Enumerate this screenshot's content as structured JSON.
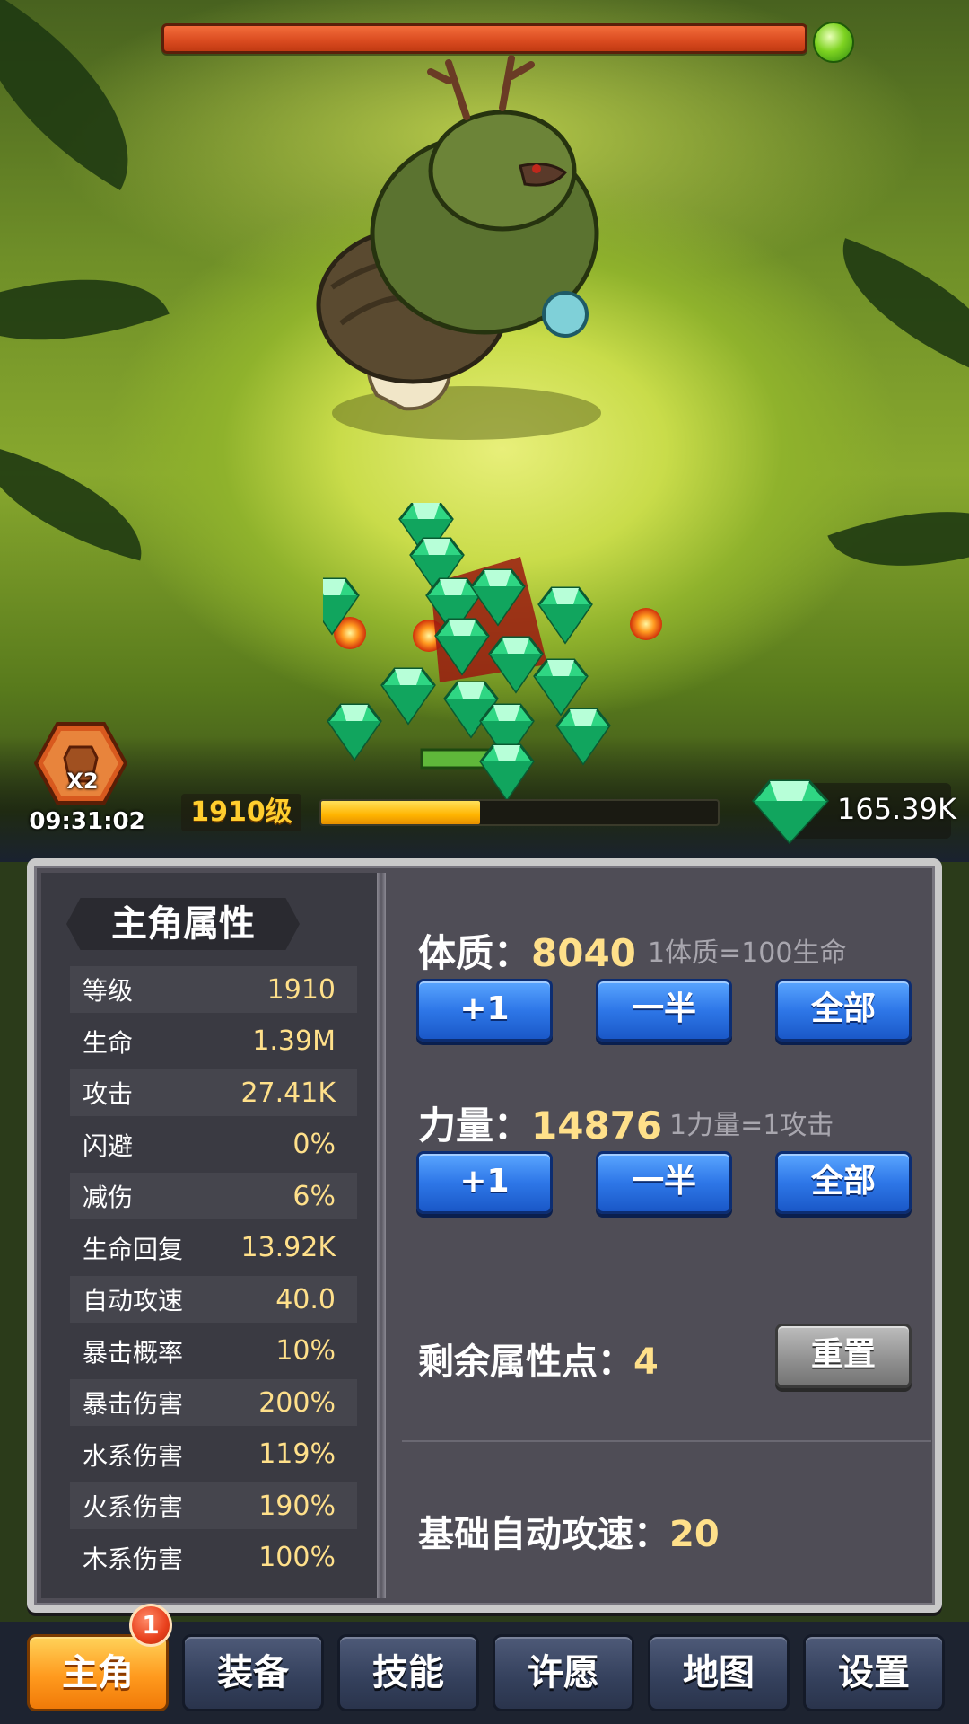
{
  "battle": {
    "boss_hp_percent": 100,
    "buff_label": "X2",
    "timer": "09:31:02",
    "level_label": "1910级",
    "exp_progress": 0.4,
    "gem_total": "165.39K"
  },
  "stats_panel": {
    "title": "主角属性",
    "rows": [
      {
        "label": "等级",
        "value": "1910"
      },
      {
        "label": "生命",
        "value": "1.39M"
      },
      {
        "label": "攻击",
        "value": "27.41K"
      },
      {
        "label": "闪避",
        "value": "0%"
      },
      {
        "label": "减伤",
        "value": "6%"
      },
      {
        "label": "生命回复",
        "value": "13.92K"
      },
      {
        "label": "自动攻速",
        "value": "40.0"
      },
      {
        "label": "暴击概率",
        "value": "10%"
      },
      {
        "label": "暴击伤害",
        "value": "200%"
      },
      {
        "label": "水系伤害",
        "value": "119%"
      },
      {
        "label": "火系伤害",
        "value": "190%"
      },
      {
        "label": "木系伤害",
        "value": "100%"
      }
    ]
  },
  "attributes": {
    "constitution": {
      "label": "体质：",
      "value": "8040",
      "note": "1体质=100生命",
      "buttons": [
        "+1",
        "一半",
        "全部"
      ]
    },
    "strength": {
      "label": "力量：",
      "value": "14876",
      "note": "1力量=1攻击",
      "buttons": [
        "+1",
        "一半",
        "全部"
      ]
    },
    "remaining": {
      "label": "剩余属性点：",
      "value": "4",
      "reset_label": "重置"
    },
    "base_speed": {
      "label": "基础自动攻速：",
      "value": "20"
    }
  },
  "nav": {
    "tabs": [
      "主角",
      "装备",
      "技能",
      "许愿",
      "地图",
      "设置"
    ],
    "active_index": 0,
    "badge": "1"
  },
  "colors": {
    "accent_gold": "#ffe08a",
    "button_blue": "#2e77e8",
    "hp_red": "#d94a1f"
  }
}
